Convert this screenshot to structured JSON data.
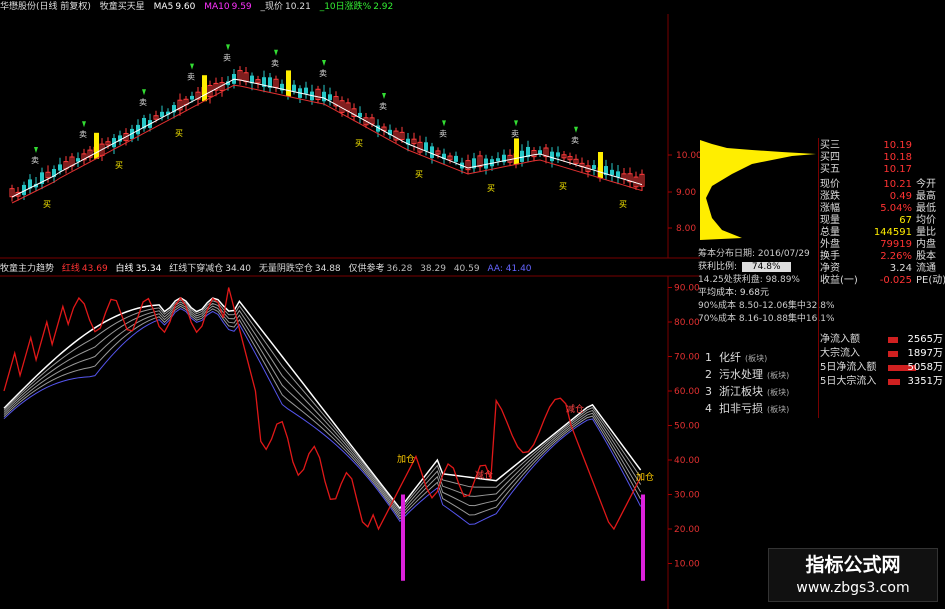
{
  "header": {
    "stock": "华懋股份(日线 前复权)",
    "indicator": "牧童买天星",
    "ma5_label": "MA5",
    "ma5": "9.60",
    "ma10_label": "MA10",
    "ma10": "9.59",
    "price_label": "_现价",
    "price": "10.21",
    "chg_label": "_10日涨跌%",
    "chg": "2.92"
  },
  "indicator_bar": {
    "title": "牧童主力趋势",
    "red_label": "红线",
    "red_value": "43.69",
    "white_label": "白线",
    "white_value": "35.34",
    "cross_label": "红线下穿减仓",
    "cross_value": "34.40",
    "empty_label": "无量阴跌空仓",
    "empty_value": "34.88",
    "ref_label": "仅供参考",
    "a5": "36.28",
    "a6": "38.29",
    "a7": "40.59",
    "aa": "AA: 41.40"
  },
  "price_axis": [
    "10.00",
    "9.00",
    "8.00"
  ],
  "osc_axis": [
    "90.00",
    "80.00",
    "70.00",
    "60.00",
    "50.00",
    "40.00",
    "30.00",
    "20.00",
    "10.00"
  ],
  "signals": {
    "buy": "买",
    "sell": "卖",
    "add": "加仓",
    "reduce": "减仓"
  },
  "chip_dist": {
    "date": "筹本分布日期: 2016/07/29",
    "profit_label": "获利比例:",
    "profit": "74.8%",
    "cost_line": "14.25处获利盘: 98.89%",
    "avg_label": "平均成本:",
    "avg": "9.68元",
    "c90": "90%成本 8.50-12.06集中32.8%",
    "c70": "70%成本 8.16-10.88集中16.1%"
  },
  "quote": [
    {
      "label": "买三",
      "value": "10.19"
    },
    {
      "label": "买四",
      "value": "10.18"
    },
    {
      "label": "买五",
      "value": "10.17"
    },
    {
      "label": "现价",
      "value": "10.21",
      "label2": "今开"
    },
    {
      "label": "涨跌",
      "value": "0.49",
      "label2": "最高"
    },
    {
      "label": "涨幅",
      "value": "5.04%",
      "label2": "最低"
    },
    {
      "label": "现量",
      "value": "67",
      "label2": "均价"
    },
    {
      "label": "总量",
      "value": "144591",
      "label2": "量比"
    },
    {
      "label": "外盘",
      "value": "79919",
      "label2": "内盘"
    },
    {
      "label": "换手",
      "value": "2.26%",
      "label2": "股本"
    },
    {
      "label": "净资",
      "value": "3.24",
      "label2": "流通"
    },
    {
      "label": "收益(一)",
      "value": "-0.025",
      "label2": "PE(动)"
    }
  ],
  "menu": [
    {
      "num": "1",
      "label": "化纤",
      "tag": "(板块)"
    },
    {
      "num": "2",
      "label": "污水处理",
      "tag": "(板块)"
    },
    {
      "num": "3",
      "label": "浙江板块",
      "tag": "(板块)"
    },
    {
      "num": "4",
      "label": "扣非亏损",
      "tag": "(板块)"
    }
  ],
  "flow": [
    {
      "label": "净流入额",
      "value": "2565万"
    },
    {
      "label": "大宗流入",
      "value": "1897万"
    },
    {
      "label": "5日净流入额",
      "value": "5058万"
    },
    {
      "label": "5日大宗流入",
      "value": "3351万"
    }
  ],
  "watermark": {
    "title": "指标公式网",
    "url": "www.zbgs3.com"
  },
  "colors": {
    "up": "#ff3b3b",
    "down": "#27c7c7",
    "yellow": "#ffee00",
    "ma5": "#ffffff",
    "red_line": "#e01818",
    "white_line": "#ffffff",
    "blue_band": "#5555ee",
    "magenta": "#dd22dd"
  }
}
